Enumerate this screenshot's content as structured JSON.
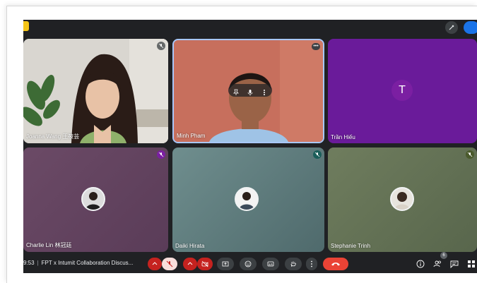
{
  "meeting": {
    "time": "9:53",
    "title": "FPT x Intumit Collaboration Discus..."
  },
  "participants": [
    {
      "name": "Joanna Wang 王筱芸",
      "type": "video"
    },
    {
      "name": "Minh Pham",
      "type": "video",
      "active_speaker": true
    },
    {
      "name": "Trần Hiếu",
      "type": "letter",
      "avatar_letter": "T"
    },
    {
      "name": "Charlie Lin 林冠廷",
      "type": "photo"
    },
    {
      "name": "Daiki Hirata",
      "type": "photo"
    },
    {
      "name": "Stephanie Trinh",
      "type": "photo"
    }
  ],
  "people_count": "6",
  "colors": {
    "meet_bg": "#202124",
    "accent_blue": "#1a73e8",
    "end_call_red": "#ea4335",
    "muted_red": "#c5221f",
    "letter_avatar": "#7b1fa2"
  },
  "icons": {
    "controls": [
      "chevron-up-icon",
      "mic-off-icon",
      "chevron-up-icon",
      "camera-off-icon",
      "present-icon",
      "emoji-icon",
      "captions-icon",
      "raise-hand-icon",
      "more-vert-icon",
      "end-call-icon"
    ],
    "right": [
      "info-icon",
      "people-icon",
      "chat-icon",
      "activities-icon"
    ]
  }
}
